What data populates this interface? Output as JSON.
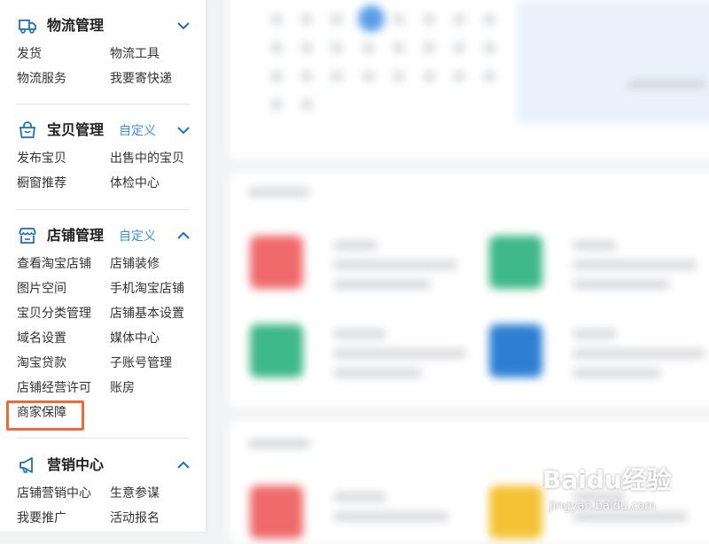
{
  "colors": {
    "accent": "#3d8fde",
    "icon_blue": "#1a6ec4",
    "highlight": "#f06a35",
    "text": "#333333"
  },
  "sidebar": {
    "logistics": {
      "icon": "truck-icon",
      "title": "物流管理",
      "expanded": false,
      "links": [
        "发货",
        "物流工具",
        "物流服务",
        "我要寄快递"
      ]
    },
    "items_mgmt": {
      "icon": "shopping-bag-icon",
      "title": "宝贝管理",
      "custom_label": "自定义",
      "expanded": false,
      "links": [
        "发布宝贝",
        "出售中的宝贝",
        "橱窗推荐",
        "体检中心"
      ]
    },
    "shop_mgmt": {
      "icon": "store-icon",
      "title": "店铺管理",
      "custom_label": "自定义",
      "expanded": true,
      "links": [
        "查看淘宝店铺",
        "店铺装修",
        "图片空间",
        "手机淘宝店铺",
        "宝贝分类管理",
        "店铺基本设置",
        "域名设置",
        "媒体中心",
        "淘宝贷款",
        "子账号管理",
        "店铺经营许可",
        "账房",
        "商家保障"
      ]
    },
    "marketing": {
      "icon": "megaphone-icon",
      "title": "营销中心",
      "expanded": true,
      "links": [
        "店铺营销中心",
        "生意参谋",
        "我要推广",
        "活动报名"
      ]
    }
  },
  "watermark": {
    "logo": "Baidu经验",
    "url": "jingyan.baidu.com"
  }
}
